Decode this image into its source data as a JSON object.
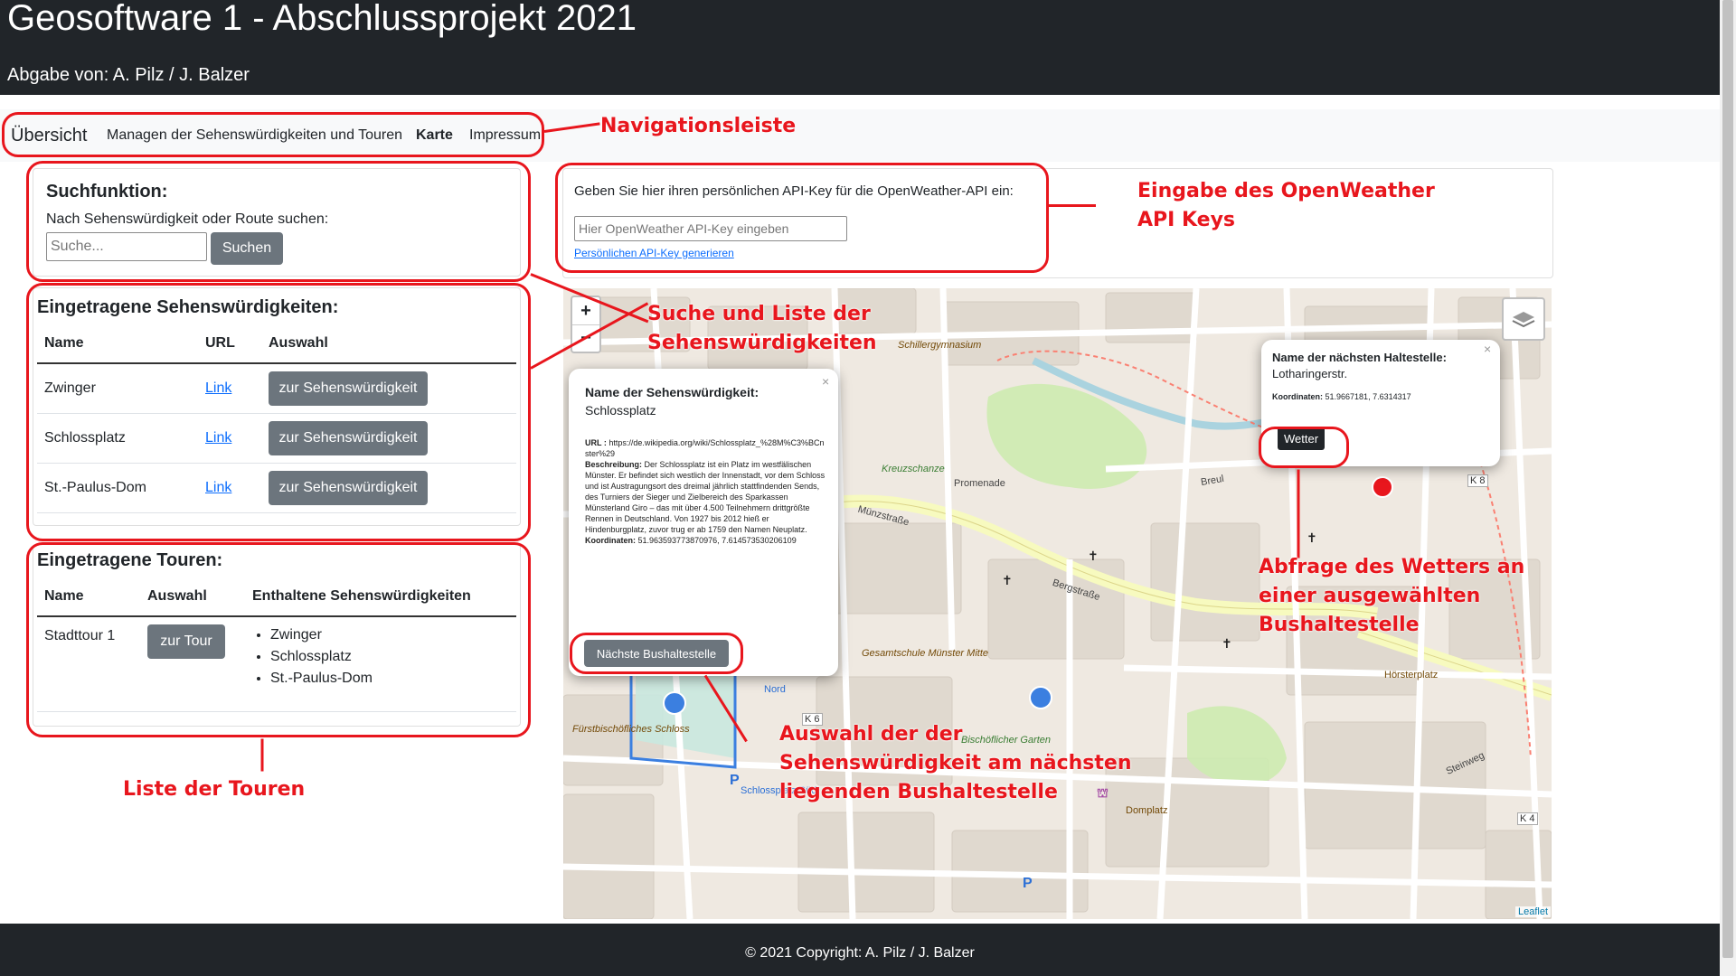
{
  "header": {
    "title": "Geosoftware 1 - Abschlussprojekt 2021",
    "subtitle": "Abgabe von: A. Pilz / J. Balzer"
  },
  "nav": {
    "items": [
      "Übersicht",
      "Managen der Sehenswürdigkeiten und Touren",
      "Karte",
      "Impressum"
    ]
  },
  "search": {
    "title": "Suchfunktion:",
    "label": "Nach Sehenswürdigkeit oder Route suchen:",
    "placeholder": "Suche...",
    "button": "Suchen"
  },
  "sights": {
    "title": "Eingetragene Sehenswürdigkeiten:",
    "columns": [
      "Name",
      "URL",
      "Auswahl"
    ],
    "rows": [
      {
        "name": "Zwinger",
        "url": "Link",
        "action": "zur Sehenswürdigkeit"
      },
      {
        "name": "Schlossplatz",
        "url": "Link",
        "action": "zur Sehenswürdigkeit"
      },
      {
        "name": "St.-Paulus-Dom",
        "url": "Link",
        "action": "zur Sehenswürdigkeit"
      }
    ]
  },
  "tours": {
    "title": "Eingetragene Touren:",
    "columns": [
      "Name",
      "Auswahl",
      "Enthaltene Sehenswürdigkeiten"
    ],
    "rows": [
      {
        "name": "Stadttour 1",
        "action": "zur Tour",
        "sights": [
          "Zwinger",
          "Schlossplatz",
          "St.-Paulus-Dom"
        ]
      }
    ]
  },
  "apikey": {
    "label": "Geben Sie hier ihren persönlichen API-Key für die OpenWeather-API ein:",
    "placeholder": "Hier OpenWeather API-Key eingeben",
    "link": "Persönlichen API-Key generieren"
  },
  "map": {
    "zoom_in": "+",
    "zoom_out": "−",
    "attribution": "Leaflet",
    "popup_sight": {
      "title": "Name der Sehenswürdigkeit:",
      "name": "Schlossplatz",
      "url_label": "URL :",
      "url_value": "https://de.wikipedia.org/wiki/Schlossplatz_%28M%C3%BCnster%29",
      "desc_label": "Beschreibung:",
      "desc_value": "Der Schlossplatz ist ein Platz im westfälischen Münster. Er befindet sich westlich der Innenstadt, vor dem Schloss und ist Austragungsort des dreimal jährlich stattfindenden Sends, des Turniers der Sieger und Zielbereich des Sparkassen Münsterland Giro – das mit über 4.500 Teilnehmern drittgrößte Rennen in Deutschland. Von 1927 bis 2012 hieß er Hindenburgplatz, zuvor trug er ab 1759 den Namen Neuplatz.",
      "coord_label": "Koordinaten:",
      "coord_value": "51.963593773870976, 7.614573530206109",
      "button": "Nächste Bushaltestelle"
    },
    "popup_stop": {
      "title": "Name der nächsten Haltestelle:",
      "name": "Lotharingerstr.",
      "coord_label": "Koordinaten:",
      "coord_value": "51.9667181, 7.6314317",
      "button": "Wetter"
    },
    "labels": [
      "Münzstraße",
      "Bergstraße",
      "Kreuzschanze",
      "Promenade",
      "Domplatz",
      "Hörsterplatz",
      "Schlossplatz Süd",
      "K 8",
      "K 6",
      "K 4",
      "Schillergymnasium",
      "Steinweg",
      "Breul",
      "Gesamtschule Münster Mitte",
      "Fürstbischöfliches Schloss",
      "Bischöflicher Garten",
      "Nord"
    ]
  },
  "annotations": {
    "navbar": "Navigationsleiste",
    "apikey": [
      "Eingabe des OpenWeather",
      "API Keys"
    ],
    "search_list": [
      "Suche und Liste der",
      "Sehenswürdigkeiten"
    ],
    "weather": [
      "Abfrage des Wetters an",
      "einer ausgewählten",
      "Bushaltestelle"
    ],
    "nearest": [
      "Auswahl der der",
      "Sehenswürdigkeit am nächsten",
      "liegenden Bushaltestelle"
    ],
    "tours": "Liste der Touren"
  },
  "footer": {
    "copyright": "© 2021 Copyright: A. Pilz / J. Balzer"
  },
  "colors": {
    "dark": "#212529",
    "annotation_red": "#e8161d",
    "button_gray": "#6c757d",
    "link_blue": "#0d6efd"
  }
}
